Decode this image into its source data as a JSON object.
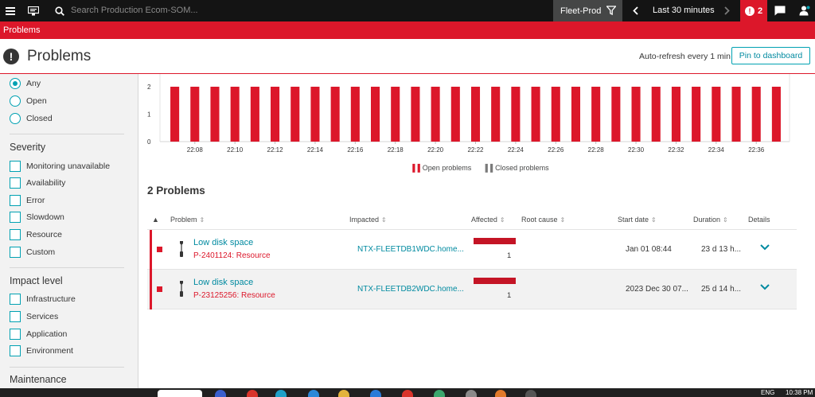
{
  "topbar": {
    "search_placeholder": "Search Production Ecom-SOM...",
    "environment": "Fleet-Prod",
    "timeframe": "Last 30 minutes",
    "problem_count": "2"
  },
  "breadcrumb": "Problems",
  "page": {
    "title": "Problems",
    "auto_refresh": "Auto-refresh every 1 min",
    "pin_label": "Pin to dashboard"
  },
  "sidebar": {
    "status_options": [
      {
        "label": "Any",
        "selected": true
      },
      {
        "label": "Open",
        "selected": false
      },
      {
        "label": "Closed",
        "selected": false
      }
    ],
    "severity": {
      "title": "Severity",
      "items": [
        "Monitoring unavailable",
        "Availability",
        "Error",
        "Slowdown",
        "Resource",
        "Custom"
      ]
    },
    "impact": {
      "title": "Impact level",
      "items": [
        "Infrastructure",
        "Services",
        "Application",
        "Environment"
      ]
    },
    "maintenance_title": "Maintenance"
  },
  "chart_data": {
    "type": "bar",
    "y_ticks": [
      "0",
      "1",
      "2"
    ],
    "ylim": [
      0,
      2
    ],
    "x_ticks": [
      "22:08",
      "22:10",
      "22:12",
      "22:14",
      "22:16",
      "22:18",
      "22:20",
      "22:22",
      "22:24",
      "22:26",
      "22:28",
      "22:30",
      "22:32",
      "22:34",
      "22:36"
    ],
    "series": [
      {
        "name": "Open problems",
        "values": [
          2,
          2,
          2,
          2,
          2,
          2,
          2,
          2,
          2,
          2,
          2,
          2,
          2,
          2,
          2,
          2,
          2,
          2,
          2,
          2,
          2,
          2,
          2,
          2,
          2,
          2,
          2,
          2,
          2,
          2,
          2
        ],
        "color": "#dc172a"
      },
      {
        "name": "Closed problems",
        "values": [
          0,
          0,
          0,
          0,
          0,
          0,
          0,
          0,
          0,
          0,
          0,
          0,
          0,
          0,
          0,
          0,
          0,
          0,
          0,
          0,
          0,
          0,
          0,
          0,
          0,
          0,
          0,
          0,
          0,
          0,
          0
        ],
        "color": "#7a7a7a"
      }
    ]
  },
  "problems": {
    "count_label": "2 Problems",
    "columns": [
      "Problem",
      "Impacted",
      "Affected",
      "Root cause",
      "Start date",
      "Duration",
      "Details"
    ],
    "rows": [
      {
        "title": "Low disk space",
        "id": "P-2401124: Resource",
        "impacted": "NTX-FLEETDB1WDC.home...",
        "affected": "1",
        "affected_fraction": 1,
        "start": "Jan 01 08:44",
        "duration": "23 d 13 h..."
      },
      {
        "title": "Low disk space",
        "id": "P-23125256: Resource",
        "impacted": "NTX-FLEETDB2WDC.home...",
        "affected": "1",
        "affected_fraction": 1,
        "start": "2023 Dec 30 07...",
        "duration": "25 d 14 h..."
      }
    ]
  },
  "taskbar": {
    "lang": "ENG",
    "time": "10:38 PM"
  },
  "colors": {
    "accent_red": "#dc172a",
    "accent_teal": "#00a1b2",
    "topbar_bg": "#141414"
  }
}
